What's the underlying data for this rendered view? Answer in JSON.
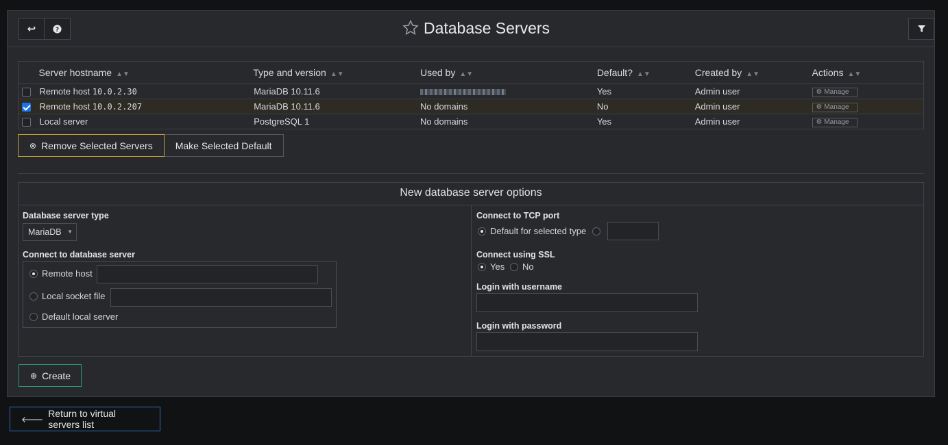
{
  "header": {
    "back_icon": "return-arrow-icon",
    "help_icon": "question-circle-icon",
    "title": "Database Servers",
    "filter_icon": "filter-icon"
  },
  "table": {
    "columns": [
      "Server hostname",
      "Type and version",
      "Used by",
      "Default?",
      "Created by",
      "Actions"
    ],
    "rows": [
      {
        "checked": false,
        "host_prefix": "Remote host",
        "host_ip": "10.0.2.30",
        "type": "MariaDB 10.11.6",
        "used_by": "",
        "default": "Yes",
        "created_by": "Admin user",
        "action": "Manage"
      },
      {
        "checked": true,
        "host_prefix": "Remote host",
        "host_ip": "10.0.2.207",
        "type": "MariaDB 10.11.6",
        "used_by": "No domains",
        "default": "No",
        "created_by": "Admin user",
        "action": "Manage"
      },
      {
        "checked": false,
        "host_prefix": "Local server",
        "host_ip": "",
        "type": "PostgreSQL 1",
        "used_by": "No domains",
        "default": "Yes",
        "created_by": "Admin user",
        "action": "Manage"
      }
    ]
  },
  "actions": {
    "remove": "Remove Selected Servers",
    "make_default": "Make Selected Default"
  },
  "options": {
    "title": "New database server options",
    "server_type_label": "Database server type",
    "server_type_value": "MariaDB",
    "connect_label": "Connect to database server",
    "connect_remote": "Remote host",
    "connect_socket": "Local socket file",
    "connect_default": "Default local server",
    "port_label": "Connect to TCP port",
    "port_default": "Default for selected type",
    "ssl_label": "Connect using SSL",
    "ssl_yes": "Yes",
    "ssl_no": "No",
    "username_label": "Login with username",
    "password_label": "Login with password",
    "create": "Create"
  },
  "footer": {
    "return": "Return to virtual servers list"
  },
  "colors": {
    "background": "#111214",
    "panel": "#27292d",
    "warning_border": "#c4a23a",
    "success_border": "#2e9c6e",
    "info_border": "#2f6fb8",
    "checkbox_on": "#1a73e8"
  }
}
